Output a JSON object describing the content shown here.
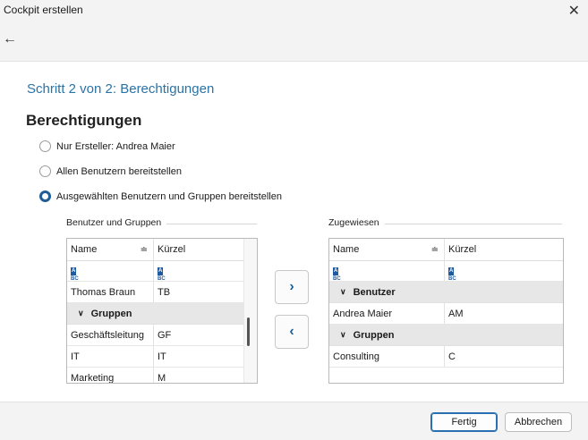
{
  "window": {
    "title": "Cockpit erstellen"
  },
  "header": {
    "step_title": "Schritt 2 von 2: Berechtigungen"
  },
  "section": {
    "title": "Berechtigungen"
  },
  "options": [
    {
      "label": "Nur Ersteller: Andrea Maier",
      "selected": false
    },
    {
      "label": "Allen Benutzern bereitstellen",
      "selected": false
    },
    {
      "label": "Ausgewählten Benutzern und Gruppen bereitstellen",
      "selected": true
    }
  ],
  "left_panel": {
    "group_label": "Benutzer und Gruppen",
    "columns": [
      "Name",
      "Kürzel"
    ],
    "rows": [
      {
        "type": "data",
        "name": "Thomas Braun",
        "code": "TB"
      },
      {
        "type": "group",
        "label": "Gruppen"
      },
      {
        "type": "data",
        "name": "Geschäftsleitung",
        "code": "GF"
      },
      {
        "type": "data",
        "name": "IT",
        "code": "IT"
      },
      {
        "type": "data",
        "name": "Marketing",
        "code": "M"
      }
    ]
  },
  "right_panel": {
    "group_label": "Zugewiesen",
    "columns": [
      "Name",
      "Kürzel"
    ],
    "rows": [
      {
        "type": "group",
        "label": "Benutzer"
      },
      {
        "type": "data",
        "name": "Andrea Maier",
        "code": "AM"
      },
      {
        "type": "group",
        "label": "Gruppen"
      },
      {
        "type": "data",
        "name": "Consulting",
        "code": "C"
      }
    ]
  },
  "buttons": {
    "finish": "Fertig",
    "cancel": "Abbrechen"
  },
  "icons": {
    "close": "close-icon",
    "back": "back-arrow-icon",
    "add": "chevron-right-icon",
    "remove": "chevron-left-icon",
    "filter": "abc-filter-icon",
    "sort": "sort-icon",
    "expand": "chevron-down-icon"
  },
  "colors": {
    "accent": "#1f5d95",
    "step_title": "#2a73a6"
  }
}
